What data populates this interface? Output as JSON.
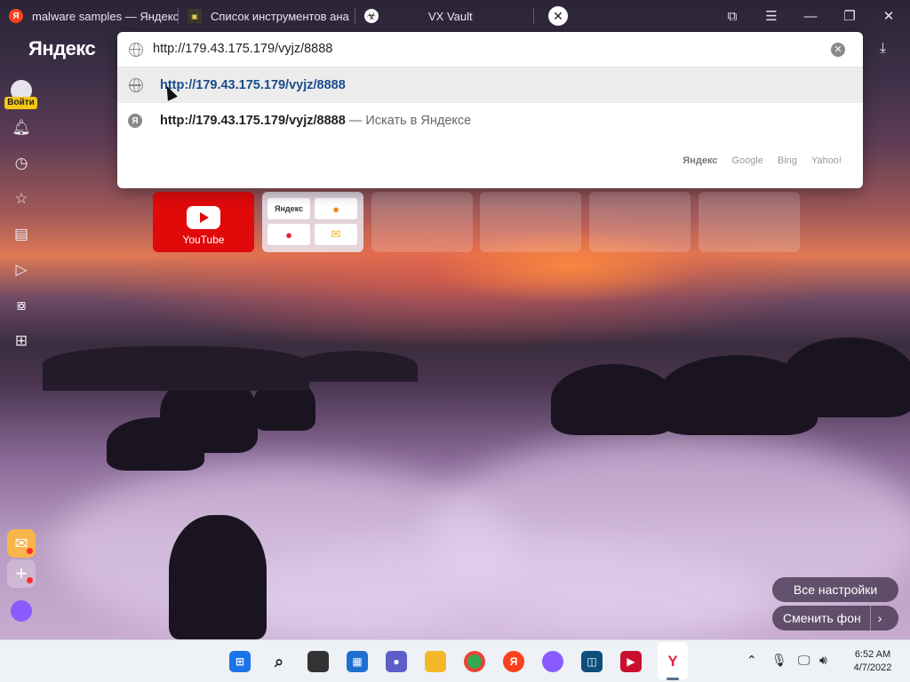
{
  "tabs": [
    {
      "title": "malware samples — Яндекс",
      "icon": "yandex-icon"
    },
    {
      "title": "Список инструментов ана",
      "icon": "site-icon"
    },
    {
      "title": "VX Vault",
      "icon": "biohazard-icon"
    }
  ],
  "browser": {
    "logo": "Яндекс",
    "address_value": "http://179.43.175.179/vyjz/8888"
  },
  "sidebar": {
    "login_label": "Войти"
  },
  "omnibox": {
    "suggestions": [
      {
        "text": "http://179.43.175.179/vyjz/8888",
        "suffix": "",
        "icon": "globe-icon"
      },
      {
        "text": "http://179.43.175.179/vyjz/8888",
        "suffix": " — Искать в Яндексе",
        "icon": "yandex-search-icon"
      }
    ],
    "engines": [
      "Яндекс",
      "Google",
      "Bing",
      "Yahoo!"
    ]
  },
  "tiles": {
    "youtube_label": "YouTube",
    "group_items": [
      "Яндекс"
    ]
  },
  "actions": {
    "all_settings": "Все настройки",
    "change_background": "Сменить фон"
  },
  "taskbar": {
    "time": "6:52 AM",
    "date": "4/7/2022"
  },
  "colors": {
    "youtube_red": "#e00a0a",
    "link_blue": "#1a4c8c",
    "login_yellow": "#f5c518"
  }
}
